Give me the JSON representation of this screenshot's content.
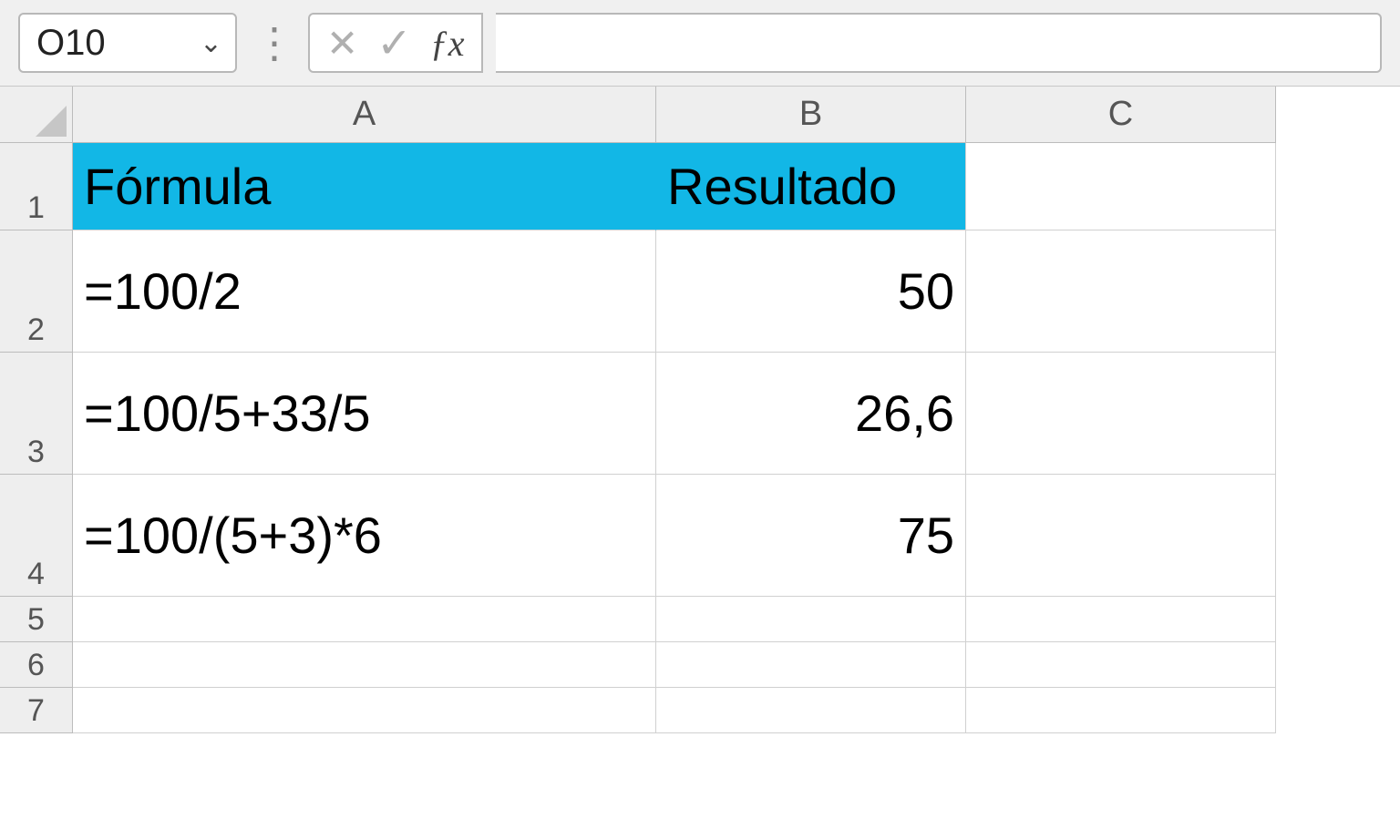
{
  "formula_bar": {
    "name_box": "O10",
    "formula_input": ""
  },
  "columns": [
    "A",
    "B",
    "C"
  ],
  "row_numbers": [
    "1",
    "2",
    "3",
    "4",
    "5",
    "6",
    "7"
  ],
  "headers": {
    "col_a": "Fórmula",
    "col_b": "Resultado"
  },
  "rows": [
    {
      "formula": "=100/2",
      "result": "50"
    },
    {
      "formula": "=100/5+33/5",
      "result": "26,6"
    },
    {
      "formula": "=100/(5+3)*6",
      "result": "75"
    }
  ],
  "colors": {
    "header_bg": "#12b7e6"
  },
  "chart_data": {
    "type": "table",
    "title": "Fórmula / Resultado",
    "columns": [
      "Fórmula",
      "Resultado"
    ],
    "rows": [
      [
        "=100/2",
        50
      ],
      [
        "=100/5+33/5",
        26.6
      ],
      [
        "=100/(5+3)*6",
        75
      ]
    ]
  }
}
